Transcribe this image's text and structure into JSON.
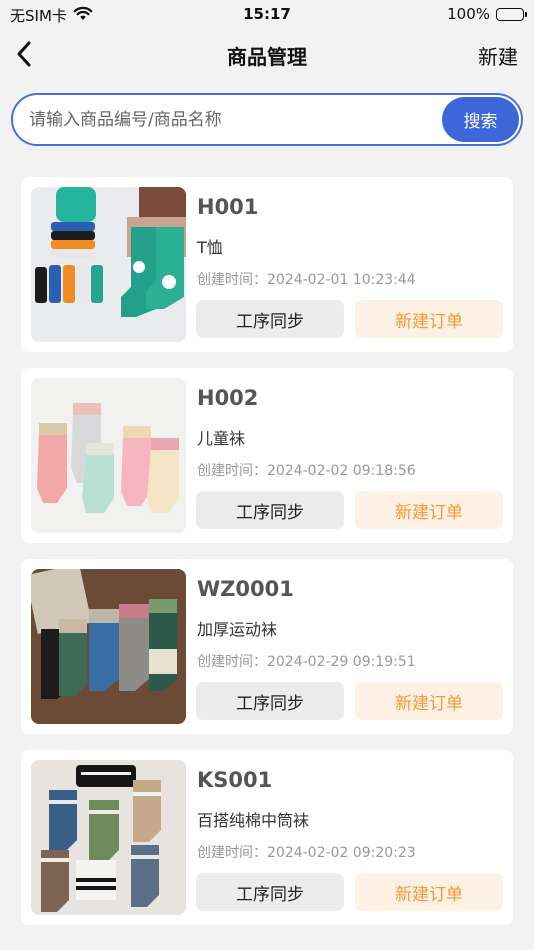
{
  "status_bar": {
    "carrier": "无SIM卡",
    "wifi_icon": "wifi-icon",
    "time": "15:17",
    "battery": "100%",
    "battery_icon": "battery-icon"
  },
  "nav": {
    "back_icon": "chevron-left-icon",
    "title": "商品管理",
    "action": "新建"
  },
  "search": {
    "placeholder": "请输入商品编号/商品名称",
    "value": "",
    "button": "搜索"
  },
  "products": [
    {
      "code": "H001",
      "name": "T恤",
      "created": "创建时间：2024-02-01 10:23:44",
      "sync_label": "工序同步",
      "order_label": "新建订单"
    },
    {
      "code": "H002",
      "name": "儿童袜",
      "created": "创建时间：2024-02-02 09:18:56",
      "sync_label": "工序同步",
      "order_label": "新建订单"
    },
    {
      "code": "WZ0001",
      "name": "加厚运动袜",
      "created": "创建时间：2024-02-29 09:19:51",
      "sync_label": "工序同步",
      "order_label": "新建订单"
    },
    {
      "code": "KS001",
      "name": "百搭纯棉中筒袜",
      "created": "创建时间：2024-02-02 09:20:23",
      "sync_label": "工序同步",
      "order_label": "新建订单"
    }
  ],
  "colors": {
    "accent": "#3d67d9",
    "order_text": "#f39a36",
    "order_bg": "#fdf1e4",
    "page_bg": "#f2f2f3"
  }
}
